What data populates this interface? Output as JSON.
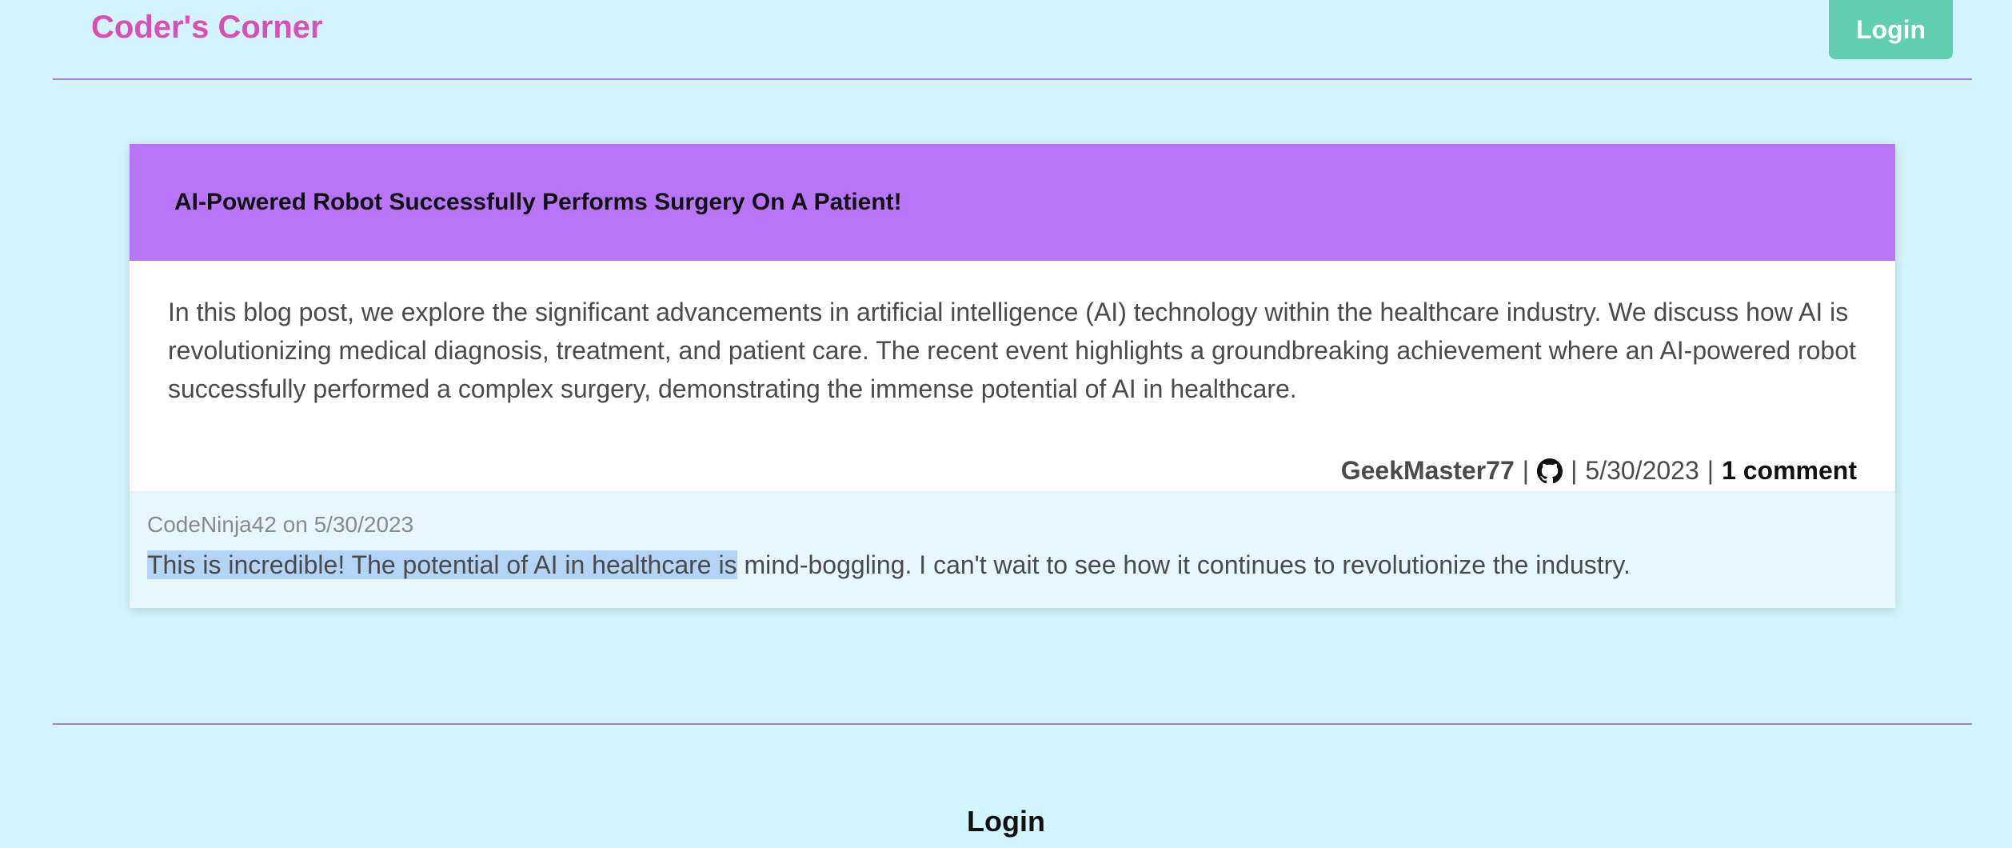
{
  "header": {
    "brand": "Coder's Corner",
    "login_label": "Login"
  },
  "post": {
    "title": "AI-Powered Robot Successfully Performs Surgery On A Patient!",
    "body": "In this blog post, we explore the significant advancements in artificial intelligence (AI) technology within the healthcare industry. We discuss how AI is revolutionizing medical diagnosis, treatment, and patient care. The recent event highlights a groundbreaking achievement where an AI-powered robot successfully performed a complex surgery, demonstrating the immense potential of AI in healthcare.",
    "author": "GeekMaster77",
    "separator": "|",
    "icon": "github-icon",
    "date": "5/30/2023",
    "comments_label": "1 comment"
  },
  "comment": {
    "meta": "CodeNinja42 on 5/30/2023",
    "text_highlighted": "This is incredible! The potential of AI in healthcare is",
    "text_rest": " mind-boggling. I can't wait to see how it continues to revolutionize the industry."
  },
  "footer": {
    "login_label": "Login"
  },
  "colors": {
    "page_bg": "#d3f5fd",
    "brand": "#d94fb8",
    "login_button": "#5fcfb0",
    "card_header": "#b875f7",
    "rule": "#b07bd8",
    "comment_bg": "#e6f8fd",
    "selection": "#b4d4f6"
  }
}
